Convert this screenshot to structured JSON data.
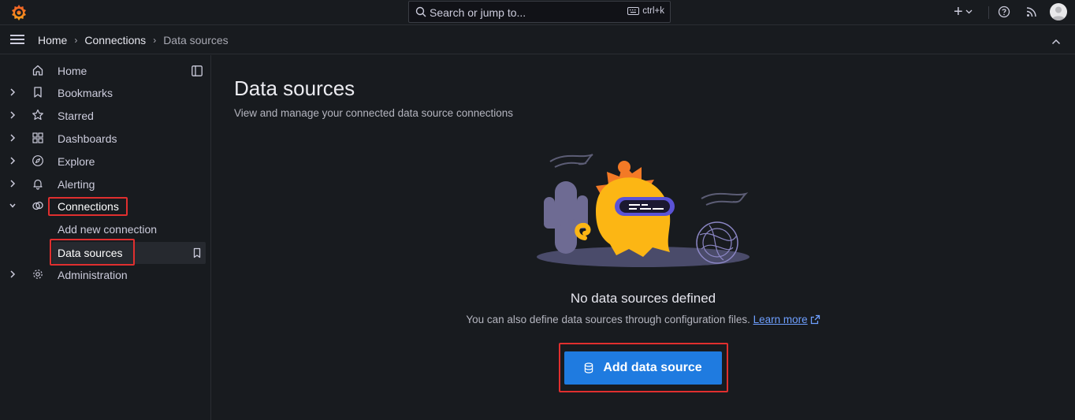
{
  "topbar": {
    "search_placeholder": "Search or jump to...",
    "shortcut": "ctrl+k",
    "plus_label": "+"
  },
  "breadcrumb": {
    "items": [
      "Home",
      "Connections",
      "Data sources"
    ]
  },
  "sidebar": {
    "items": [
      {
        "label": "Home",
        "icon": "home-icon"
      },
      {
        "label": "Bookmarks",
        "icon": "bookmark-icon"
      },
      {
        "label": "Starred",
        "icon": "star-icon"
      },
      {
        "label": "Dashboards",
        "icon": "apps-icon"
      },
      {
        "label": "Explore",
        "icon": "compass-icon"
      },
      {
        "label": "Alerting",
        "icon": "bell-icon"
      },
      {
        "label": "Connections",
        "icon": "link-icon"
      },
      {
        "label": "Administration",
        "icon": "cog-icon"
      }
    ],
    "connections_children": [
      "Add new connection",
      "Data sources"
    ]
  },
  "main": {
    "title": "Data sources",
    "subtitle": "View and manage your connected data source connections",
    "empty_title": "No data sources defined",
    "empty_text": "You can also define data sources through configuration files.",
    "learn_more": "Learn more",
    "add_button": "Add data source"
  },
  "colors": {
    "background": "#181b1f",
    "primary_button": "#1f7be0",
    "highlight_box": "#e02f2f",
    "link": "#6e9fff"
  }
}
